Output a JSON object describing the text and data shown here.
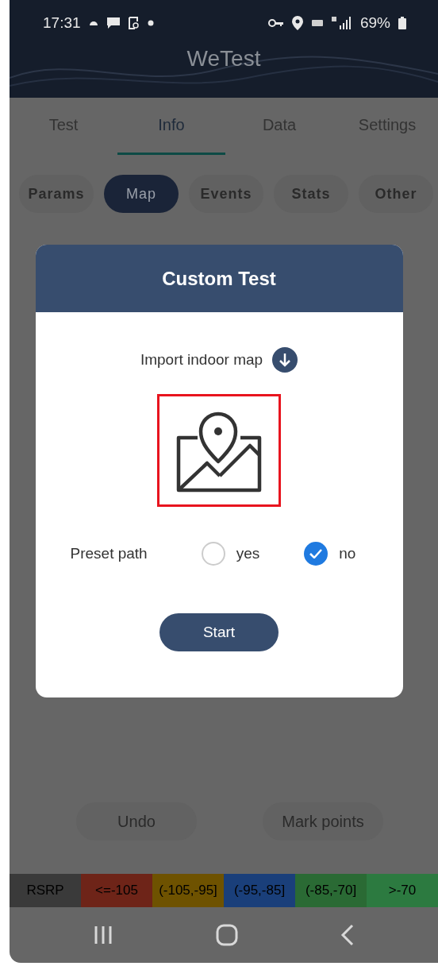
{
  "status_bar": {
    "time": "17:31",
    "battery": "69%"
  },
  "header": {
    "title": "WeTest"
  },
  "tabs": [
    {
      "label": "Test",
      "selected": false
    },
    {
      "label": "Info",
      "selected": true
    },
    {
      "label": "Data",
      "selected": false
    },
    {
      "label": "Settings",
      "selected": false
    }
  ],
  "sub_tabs": [
    {
      "label": "Params",
      "selected": false
    },
    {
      "label": "Map",
      "selected": true
    },
    {
      "label": "Events",
      "selected": false
    },
    {
      "label": "Stats",
      "selected": false
    },
    {
      "label": "Other",
      "selected": false
    }
  ],
  "dialog": {
    "title": "Custom Test",
    "import_label": "Import indoor map",
    "preset_label": "Preset path",
    "options": [
      {
        "label": "yes",
        "selected": false
      },
      {
        "label": "no",
        "selected": true
      }
    ],
    "start_button": "Start"
  },
  "actions": [
    "Undo",
    "Mark points"
  ],
  "legend": [
    {
      "label": "RSRP",
      "color": "#3a3a3a"
    },
    {
      "label": "<=-105",
      "color": "#6e2418"
    },
    {
      "label": "(-105,-95]",
      "color": "#6e5200"
    },
    {
      "label": "(-95,-85]",
      "color": "#1a3f7a"
    },
    {
      "label": "(-85,-70]",
      "color": "#2a6a34"
    },
    {
      "label": ">-70",
      "color": "#2c7a40"
    }
  ]
}
